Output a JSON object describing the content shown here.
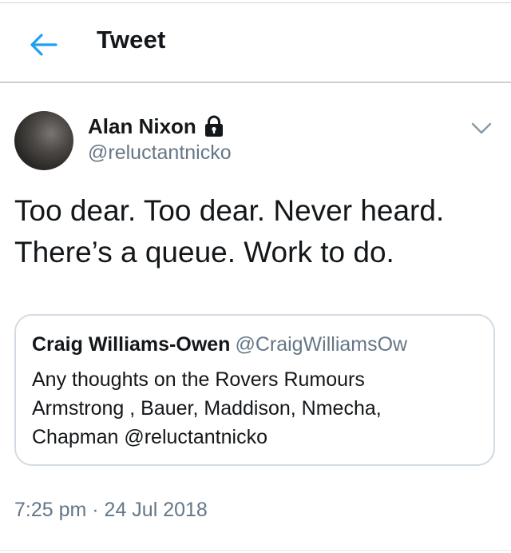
{
  "header": {
    "title": "Tweet",
    "back_icon": "back-arrow-icon",
    "accent_color": "#1da1f2"
  },
  "tweet": {
    "author_name": "Alan Nixon",
    "author_handle": "@reluctantnicko",
    "protected_icon": "lock-icon",
    "menu_icon": "chevron-down-icon",
    "text": "Too dear. Too dear. Never heard. There’s a queue. Work to do.",
    "timestamp": "7:25 pm · 24 Jul 2018"
  },
  "quoted_tweet": {
    "author_name": "Craig Williams-Owen",
    "author_handle": "@CraigWilliamsOw",
    "text": "Any thoughts on the Rovers Rumours\nArmstrong , Bauer, Maddison, Nmecha,\nChapman @reluctantnicko"
  },
  "colors": {
    "text_primary": "#14171a",
    "text_secondary": "#657786",
    "border": "#d2dbe2"
  }
}
